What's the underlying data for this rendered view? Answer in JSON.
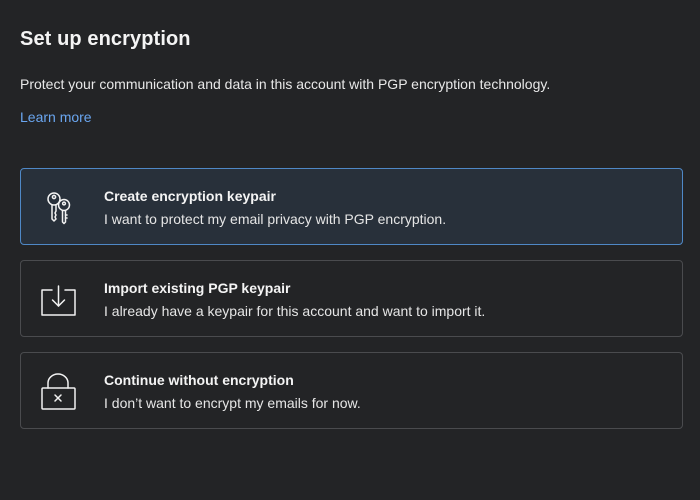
{
  "header": {
    "title": "Set up encryption",
    "description": "Protect your communication and data in this account with PGP encryption technology.",
    "learn_more_label": "Learn more"
  },
  "options": [
    {
      "icon": "keys-icon",
      "title": "Create encryption keypair",
      "description": "I want to protect my email privacy with PGP encryption.",
      "selected": true
    },
    {
      "icon": "import-icon",
      "title": "Import existing PGP keypair",
      "description": "I already have a keypair for this account and want to import it.",
      "selected": false
    },
    {
      "icon": "unlocked-padlock-icon",
      "title": "Continue without encryption",
      "description": "I don’t want to encrypt my emails for now.",
      "selected": false
    }
  ],
  "colors": {
    "background": "#232426",
    "accent_link": "#6aa6f0",
    "selected_border": "#4f88c6",
    "selected_background": "#28303a",
    "card_border": "#4a4b4e"
  }
}
